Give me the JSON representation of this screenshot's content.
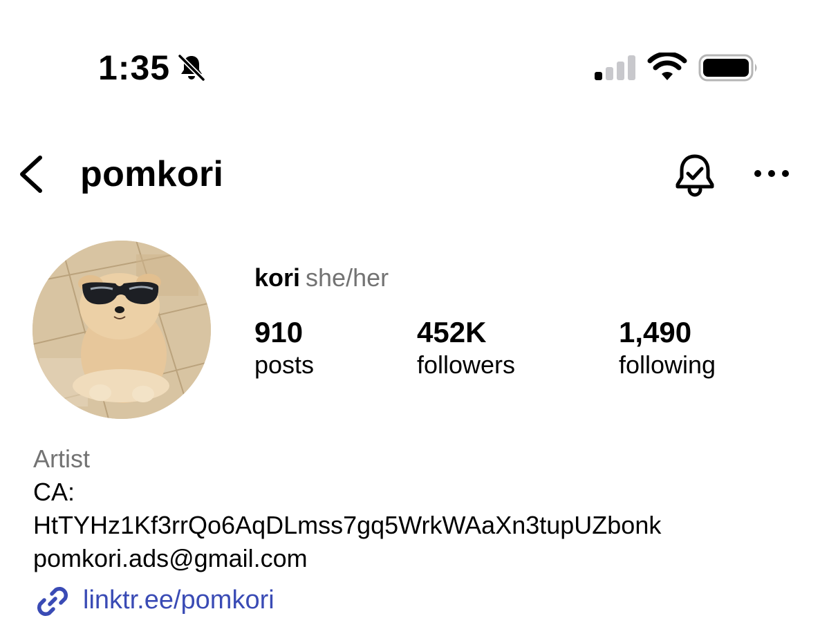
{
  "status_bar": {
    "time": "1:35",
    "icons": [
      "bell-slash-icon",
      "cellular-signal-icon",
      "wifi-icon",
      "battery-icon"
    ],
    "signal_bars_filled": 1,
    "signal_bars_total": 4
  },
  "header": {
    "username": "pomkori",
    "icons": [
      "back-chevron-icon",
      "bell-check-icon",
      "more-dots-icon"
    ]
  },
  "profile": {
    "display_name": "kori",
    "pronouns": "she/her",
    "avatar": "profile-photo-pomeranian-in-sunglasses"
  },
  "stats": {
    "posts": {
      "value": "910",
      "label": "posts"
    },
    "followers": {
      "value": "452K",
      "label": "followers"
    },
    "following": {
      "value": "1,490",
      "label": "following"
    }
  },
  "bio": {
    "category": "Artist",
    "line1": "CA:",
    "line2": "HtTYHz1Kf3rrQo6AqDLmss7gq5WrkWAaXn3tupUZbonk",
    "line3": "pomkori.ads@gmail.com"
  },
  "link": {
    "text": "linktr.ee/pomkori",
    "icon": "link-icon"
  },
  "colors": {
    "text": "#000000",
    "secondary": "#737373",
    "link": "#3a4bb5",
    "signal_inactive": "#c8c8cc"
  }
}
